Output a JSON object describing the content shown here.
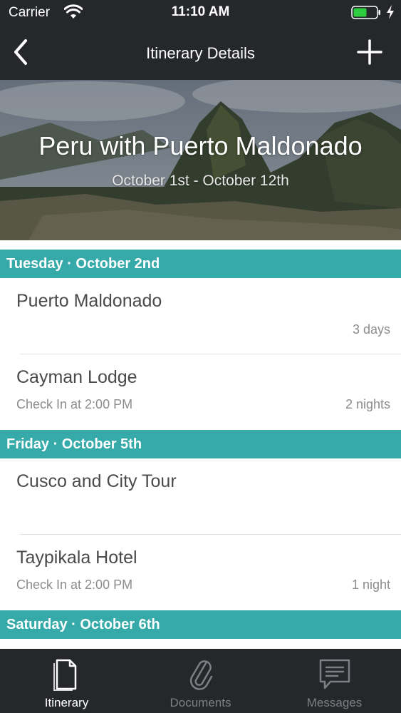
{
  "status_bar": {
    "carrier": "Carrier",
    "time": "11:10 AM",
    "battery_color": "#2ecc40"
  },
  "nav": {
    "title": "Itinerary Details",
    "back_icon": "chevron-left-icon",
    "add_icon": "plus-icon"
  },
  "hero": {
    "title": "Peru with Puerto Maldonado",
    "dates": "October 1st - October 12th"
  },
  "sections": [
    {
      "header": "Tuesday · October 2nd",
      "items": [
        {
          "title": "Puerto Maldonado",
          "subtitle": "",
          "duration": "3 days"
        },
        {
          "title": "Cayman Lodge",
          "subtitle": "Check In at 2:00 PM",
          "duration": "2 nights"
        }
      ]
    },
    {
      "header": "Friday · October 5th",
      "items": [
        {
          "title": "Cusco and City Tour",
          "subtitle": "",
          "duration": ""
        },
        {
          "title": "Taypikala Hotel",
          "subtitle": "Check In at 2:00 PM",
          "duration": "1 night"
        }
      ]
    },
    {
      "header": "Saturday · October 6th",
      "items": []
    }
  ],
  "tabs": [
    {
      "label": "Itinerary",
      "icon": "document-icon",
      "active": true
    },
    {
      "label": "Documents",
      "icon": "paperclip-icon",
      "active": false
    },
    {
      "label": "Messages",
      "icon": "message-icon",
      "active": false
    }
  ],
  "colors": {
    "accent": "#36a9a9",
    "dark": "#25272b",
    "tab_active": "#ffffff",
    "tab_inactive": "#7d7f84"
  }
}
